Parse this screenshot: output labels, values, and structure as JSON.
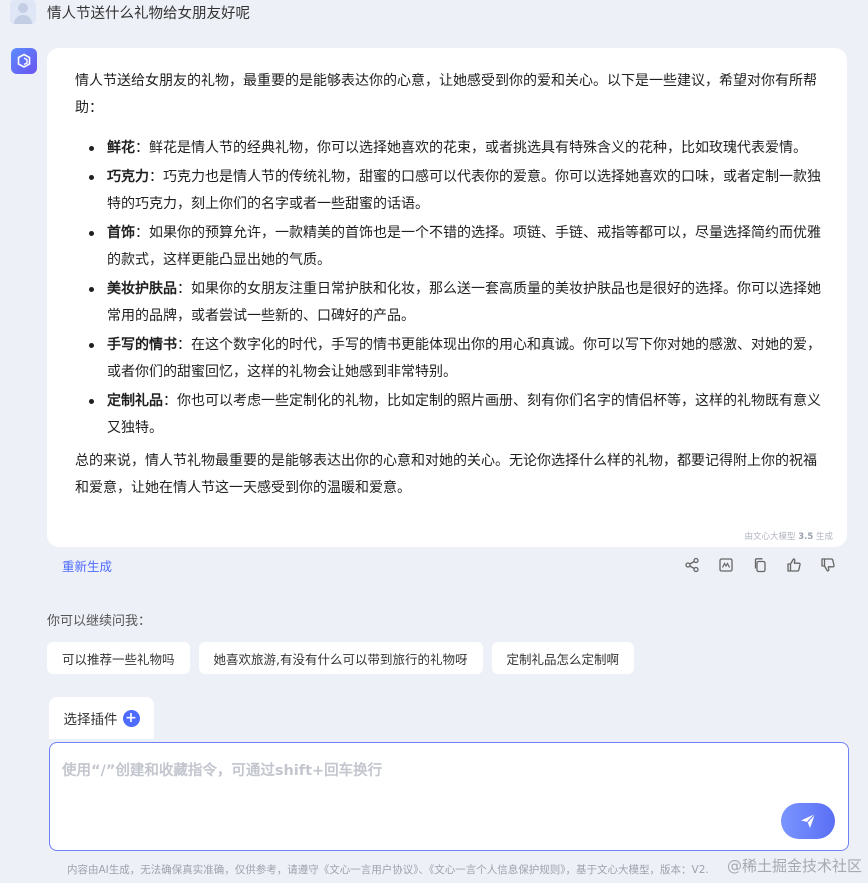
{
  "user_question": "情人节送什么礼物给女朋友好呢",
  "answer": {
    "intro": "情人节送给女朋友的礼物，最重要的是能够表达你的心意，让她感受到你的爱和关心。以下是一些建议，希望对你有所帮助：",
    "items": [
      {
        "title": "鲜花",
        "text": "：鲜花是情人节的经典礼物，你可以选择她喜欢的花束，或者挑选具有特殊含义的花种，比如玫瑰代表爱情。"
      },
      {
        "title": "巧克力",
        "text": "：巧克力也是情人节的传统礼物，甜蜜的口感可以代表你的爱意。你可以选择她喜欢的口味，或者定制一款独特的巧克力，刻上你们的名字或者一些甜蜜的话语。"
      },
      {
        "title": "首饰",
        "text": "：如果你的预算允许，一款精美的首饰也是一个不错的选择。项链、手链、戒指等都可以，尽量选择简约而优雅的款式，这样更能凸显出她的气质。"
      },
      {
        "title": "美妆护肤品",
        "text": "：如果你的女朋友注重日常护肤和化妆，那么送一套高质量的美妆护肤品也是很好的选择。你可以选择她常用的品牌，或者尝试一些新的、口碑好的产品。"
      },
      {
        "title": "手写的情书",
        "text": "：在这个数字化的时代，手写的情书更能体现出你的用心和真诚。你可以写下你对她的感激、对她的爱，或者你们的甜蜜回忆，这样的礼物会让她感到非常特别。"
      },
      {
        "title": "定制礼品",
        "text": "：你也可以考虑一些定制化的礼物，比如定制的照片画册、刻有你们名字的情侣杯等，这样的礼物既有意义又独特。"
      }
    ],
    "conclusion": "总的来说，情人节礼物最重要的是能够表达出你的心意和对她的关心。无论你选择什么样的礼物，都要记得附上你的祝福和爱意，让她在情人节这一天感受到你的温暖和爱意。",
    "footer_prefix": "由文心大模型 ",
    "footer_version": "3.5",
    "footer_suffix": " 生成"
  },
  "actions": {
    "regenerate_label": "重新生成",
    "icons": [
      "share-icon",
      "image-icon",
      "copy-icon",
      "thumbs-up-icon",
      "thumbs-down-icon"
    ]
  },
  "continue_label": "你可以继续问我：",
  "suggestions": [
    "可以推荐一些礼物吗",
    "她喜欢旅游,有没有什么可以带到旅行的礼物呀",
    "定制礼品怎么定制啊"
  ],
  "plugin_label": "选择插件",
  "input": {
    "placeholder": "使用“/”创建和收藏指令，可通过shift+回车换行",
    "value": ""
  },
  "disclaimer": "内容由AI生成，无法确保真实准确，仅供参考，请遵守《文心一言用户协议》、《文心一言个人信息保护规则》，基于文心大模型，版本：V2.",
  "watermark": "@稀土掘金技术社区",
  "colors": {
    "accent": "#4d6bfe",
    "background": "#eef0f7",
    "card": "#ffffff",
    "input_border": "#6e82f4"
  }
}
